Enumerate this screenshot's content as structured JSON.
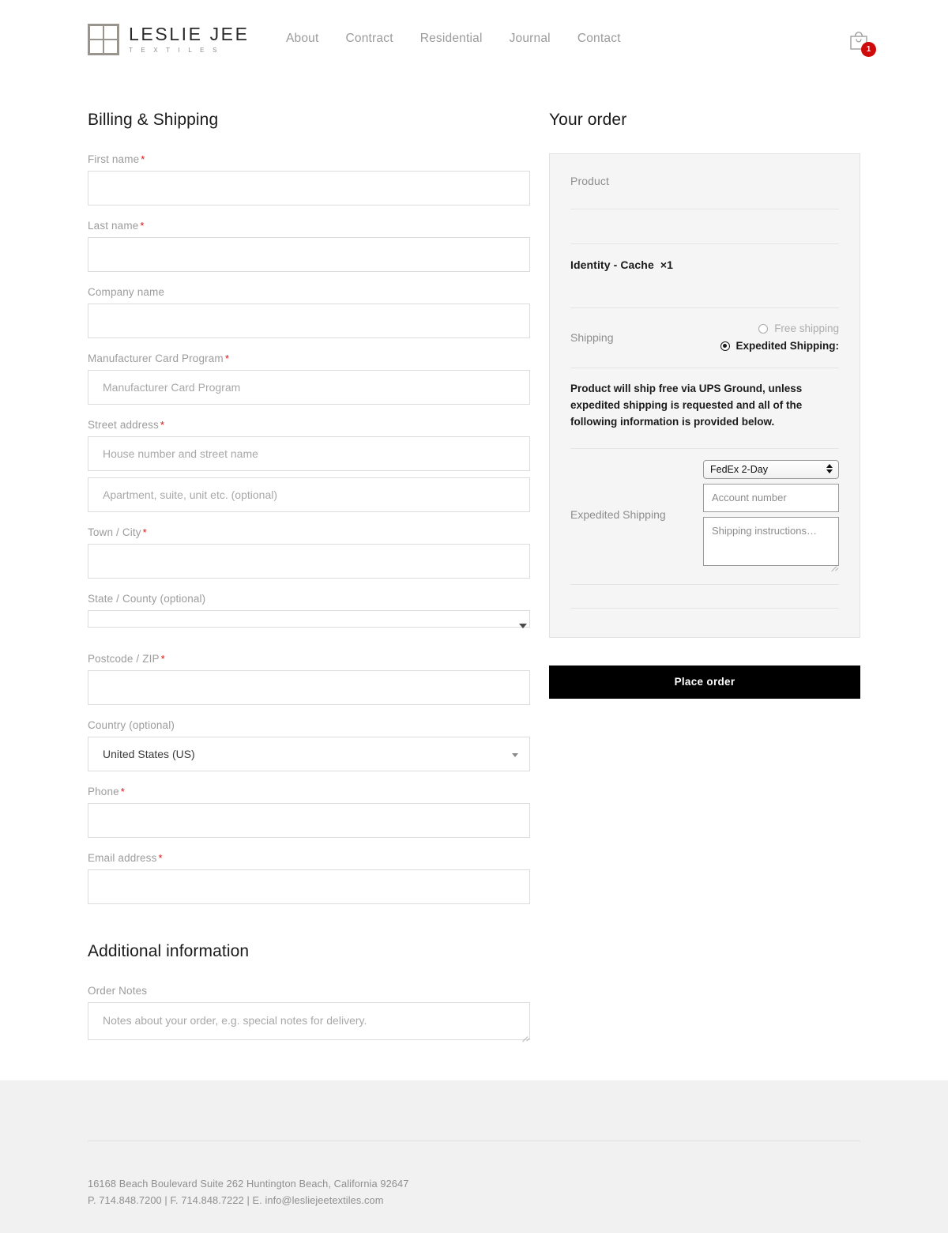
{
  "header": {
    "brand_name": "LESLIE JEE",
    "brand_sub": "T E X T I L E S",
    "logo_icon": "spiral-grid-logo",
    "nav": [
      {
        "label": "About"
      },
      {
        "label": "Contract"
      },
      {
        "label": "Residential"
      },
      {
        "label": "Journal"
      },
      {
        "label": "Contact"
      }
    ],
    "cart": {
      "icon": "shopping-bag-icon",
      "count": "1",
      "badge_color": "#cf0a0a"
    }
  },
  "billing": {
    "title": "Billing & Shipping",
    "required_mark": "*",
    "fields": {
      "first_name": {
        "label": "First name",
        "value": "",
        "placeholder": ""
      },
      "last_name": {
        "label": "Last name",
        "value": "",
        "placeholder": ""
      },
      "company": {
        "label": "Company name",
        "value": "",
        "placeholder": ""
      },
      "manufacturer_card": {
        "label": "Manufacturer Card Program",
        "value": "",
        "placeholder": "Manufacturer Card Program"
      },
      "street": {
        "label": "Street address",
        "value": "",
        "placeholder": "House number and street name"
      },
      "street2": {
        "value": "",
        "placeholder": "Apartment, suite, unit etc. (optional)"
      },
      "town": {
        "label": "Town / City",
        "value": "",
        "placeholder": ""
      },
      "state": {
        "label": "State / County (optional)",
        "value": ""
      },
      "postcode": {
        "label": "Postcode / ZIP",
        "value": "",
        "placeholder": ""
      },
      "country": {
        "label": "Country (optional)",
        "value": "United States (US)"
      },
      "phone": {
        "label": "Phone",
        "value": "",
        "placeholder": ""
      },
      "email": {
        "label": "Email address",
        "value": "",
        "placeholder": ""
      }
    }
  },
  "additional": {
    "title": "Additional information",
    "order_notes": {
      "label": "Order Notes",
      "value": "",
      "placeholder": "Notes about your order, e.g. special notes for delivery."
    }
  },
  "order": {
    "title": "Your order",
    "product_header": "Product",
    "items": [
      {
        "name": "Identity - Cache",
        "qty": "×1"
      }
    ],
    "shipping_label": "Shipping",
    "shipping_options": [
      {
        "label": "Free shipping",
        "selected": false
      },
      {
        "label": "Expedited Shipping:",
        "selected": true
      }
    ],
    "shipping_note": "Product will ship free via UPS Ground, unless expedited shipping is requested and all of the following information is provided below.",
    "expedited_label": "Expedited Shipping",
    "carrier_select": {
      "value": "FedEx 2-Day"
    },
    "account_number": {
      "value": "",
      "placeholder": "Account number"
    },
    "instructions": {
      "value": "",
      "placeholder": "Shipping instructions…"
    },
    "place_order_label": "Place order"
  },
  "footer": {
    "address": "16168 Beach Boulevard Suite 262 Huntington Beach, California 92647",
    "contact": "P. 714.848.7200 | F. 714.848.7222 | E. info@lesliejeetextiles.com"
  }
}
